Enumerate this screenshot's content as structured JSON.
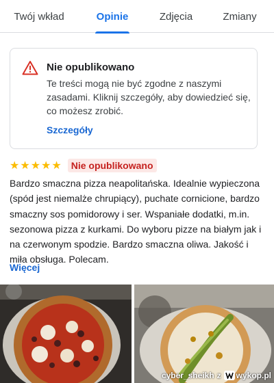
{
  "tabs": [
    {
      "label": "Twój wkład",
      "active": false
    },
    {
      "label": "Opinie",
      "active": true
    },
    {
      "label": "Zdjęcia",
      "active": false
    },
    {
      "label": "Zmiany",
      "active": false
    }
  ],
  "alert": {
    "icon": "warning-icon",
    "title": "Nie opublikowano",
    "text": "Te treści mogą nie być zgodne z naszymi zasadami. Kliknij szczegóły, aby dowiedzieć się, co możesz zrobić.",
    "link": "Szczegóły",
    "icon_color": "#d93025"
  },
  "review": {
    "rating": 5,
    "stars": "★★★★★",
    "status": "Nie opublikowano",
    "text": "Bardzo smaczna pizza neapolitańska. Idealnie wypieczona (spód jest niemalże chrupiący), puchate cornicione, bardzo smaczny sos pomidorowy i ser. Wspaniałe dodatki, m.in. sezonowa pizza z kurkami. Do wyboru pizze na białym jak i na czerwonym spodzie. Bardzo smaczna oliwa. Jakość i miła obsługa. Polecam.",
    "more": "Więcej"
  },
  "photos": [
    {
      "name": "pizza-red-photo"
    },
    {
      "name": "pizza-green-photo"
    }
  ],
  "watermark": {
    "user": "cyber_sheikh",
    "sep": "z",
    "brand": "wykop.pl"
  },
  "colors": {
    "accent": "#1a73e8",
    "link": "#1967d2",
    "star": "#fbbc04",
    "badge_bg": "#fce8e6",
    "badge_text": "#c5221f"
  }
}
